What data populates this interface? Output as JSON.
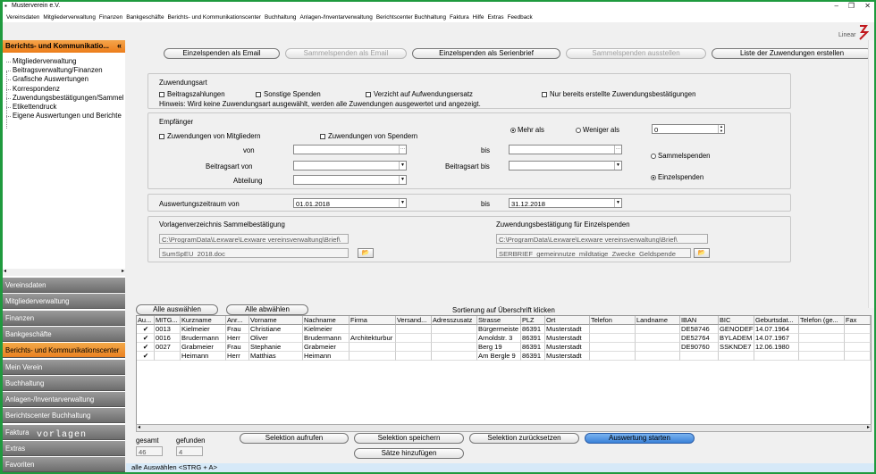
{
  "window": {
    "title": "Musterverein e.V."
  },
  "menu": [
    "Vereinsdaten",
    "Mitgliederverwaltung",
    "Finanzen",
    "Bankgeschäfte",
    "Berichts- und Kommunikationscenter",
    "Buchhaltung",
    "Anlagen-/Inventarverwaltung",
    "Berichtscenter Buchhaltung",
    "Faktura",
    "Hilfe",
    "Extras",
    "Feedback"
  ],
  "logo": "Linear",
  "sidebar": {
    "title": "Berichts- und Kommunikatio...",
    "collapse": "«",
    "tree": [
      "Mitgliederverwaltung",
      "Beitragsverwaltung/Finanzen",
      "Grafische Auswertungen",
      "Korrespondenz",
      "Zuwendungsbestätigungen/Sammel",
      "Etikettendruck",
      "Eigene Auswertungen und Berichte"
    ],
    "nav": [
      "Vereinsdaten",
      "Mitgliederverwaltung",
      "Finanzen",
      "Bankgeschäfte",
      "Berichts- und Kommunikationscenter",
      "Mein Verein",
      "Buchhaltung",
      "Anlagen-/Inventarverwaltung",
      "Berichtscenter Buchhaltung",
      "Faktura",
      "Extras",
      "Favoriten"
    ],
    "watermark": "vorlagen"
  },
  "toolbar": {
    "b1": "Einzelspenden als Email",
    "b2": "Sammelspenden als Email",
    "b3": "Einzelspenden als Serienbrief",
    "b4": "Sammelspenden ausstellen",
    "b5": "Liste der Zuwendungen erstellen"
  },
  "zuwendungsart": {
    "title": "Zuwendungsart",
    "c1": "Beitragszahlungen",
    "c2": "Sonstige Spenden",
    "c3": "Verzicht auf Aufwendungsersatz",
    "c4": "Nur bereits erstellte Zuwendungsbestätigungen",
    "hint": "Hinweis: Wird keine Zuwendungsart ausgewählt, werden alle Zuwendungen ausgewertet und angezeigt."
  },
  "empfaenger": {
    "title": "Empfänger",
    "c1": "Zuwendungen von Mitgliedern",
    "c2": "Zuwendungen von Spendern",
    "von": "von",
    "bis": "bis",
    "beitragsart_von": "Beitragsart von",
    "beitragsart_bis": "Beitragsart bis",
    "abteilung": "Abteilung",
    "mehr": "Mehr als",
    "weniger": "Weniger als",
    "betrag": "0",
    "sammel": "Sammelspenden",
    "einzel": "Einzelspenden"
  },
  "zeitraum": {
    "label": "Auswertungszeitraum von",
    "von": "01.01.2018",
    "bis_label": "bis",
    "bis": "31.12.2018"
  },
  "vorlagen": {
    "sammel_label": "Vorlagenverzeichnis Sammelbestätigung",
    "sammel_path": "C:\\ProgramData\\Lexware\\Lexware vereinsverwaltung\\Brief\\",
    "sammel_file": "SumSpEU_2018.doc",
    "einzel_label": "Zuwendungsbestätigung für Einzelspenden",
    "einzel_path": "C:\\ProgramData\\Lexware\\Lexware vereinsverwaltung\\Brief\\",
    "einzel_file": "SERBRIEF_gemeinnutze_mildtatige_Zwecke_Geldspende_"
  },
  "grid": {
    "select_all": "Alle auswählen",
    "deselect_all": "Alle abwählen",
    "sort_hint": "Sortierung auf Überschrift klicken",
    "columns": [
      "Au...",
      "MITG...",
      "Kurzname",
      "Anr...",
      "Vorname",
      "Nachname",
      "Firma",
      "Versand...",
      "Adresszusatz",
      "Strasse",
      "PLZ",
      "Ort",
      "Telefon",
      "Landname",
      "IBAN",
      "BIC",
      "Geburtsdat...",
      "Telefon (ge...",
      "Fax"
    ],
    "rows": [
      [
        "✔",
        "0013",
        "Kielmeier",
        "Frau",
        "Christiane",
        "Kielmeier",
        "",
        "",
        "",
        "Bürgermeiste",
        "86391",
        "Musterstadt",
        "",
        "",
        "DE58746",
        "GENODEF",
        "14.07.1964",
        "",
        ""
      ],
      [
        "✔",
        "0016",
        "Brudermann",
        "Herr",
        "Oliver",
        "Brudermann",
        "Architekturbur",
        "",
        "",
        "Arnoldstr. 3",
        "86391",
        "Musterstadt",
        "",
        "",
        "DE52764",
        "BYLADEM",
        "14.07.1967",
        "",
        ""
      ],
      [
        "✔",
        "0027",
        "Grabmeier",
        "Frau",
        "Stephanie",
        "Grabmeier",
        "",
        "",
        "",
        "Berg 19",
        "86391",
        "Musterstadt",
        "",
        "",
        "DE90760",
        "SSKNDE7",
        "12.06.1980",
        "",
        ""
      ],
      [
        "✔",
        "",
        "Heimann",
        "Herr",
        "Matthias",
        "Heimann",
        "",
        "",
        "",
        "Am Bergle 9",
        "86391",
        "Musterstadt",
        "",
        "",
        "",
        "",
        "",
        "",
        ""
      ]
    ]
  },
  "footer": {
    "gesamt_label": "gesamt",
    "gesamt": "46",
    "gefunden_label": "gefunden",
    "gefunden": "4",
    "b_aufrufen": "Selektion aufrufen",
    "b_speichern": "Selektion speichern",
    "b_reset": "Selektion zurücksetzen",
    "b_start": "Auswertung starten",
    "b_saetze": "Sätze hinzufügen"
  },
  "status": "alle Auswählen <STRG + A>"
}
